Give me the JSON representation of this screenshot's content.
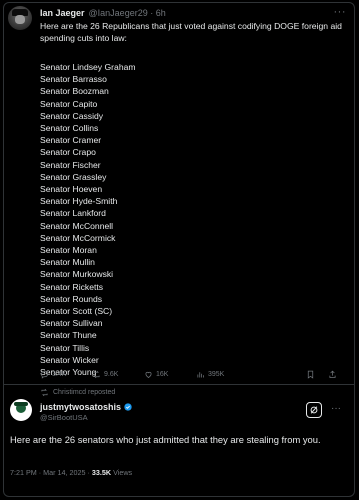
{
  "tweet": {
    "author_name": "Ian Jaeger",
    "author_handle": "@IanJaeger29 · 6h",
    "text": "Here are the 26 Republicans that just voted against codifying DOGE foreign aid spending cuts into law:",
    "senators": [
      "Senator Lindsey Graham",
      "Senator Barrasso",
      "Senator Boozman",
      "Senator Capito",
      "Senator Cassidy",
      "Senator Collins",
      "Senator Cramer",
      "Senator Crapo",
      "Senator Fischer",
      "Senator Grassley",
      "Senator Hoeven",
      "Senator Hyde-Smith",
      "Senator Lankford",
      "Senator McConnell",
      "Senator McCormick",
      "Senator Moran",
      "Senator Mullin",
      "Senator Murkowski",
      "Senator Ricketts",
      "Senator Rounds",
      "Senator Scott (SC)",
      "Senator Sullivan",
      "Senator Thune",
      "Senator Tillis",
      "Senator Wicker",
      "Senator Young"
    ],
    "actions": {
      "replies": "3.4K",
      "reposts": "9.6K",
      "likes": "16K",
      "views": "395K"
    }
  },
  "repost": {
    "reposted_by": "Christimcd reposted",
    "author_name": "justmytwosatoshis",
    "author_handle": "@SirBootUSA",
    "text": "Here are the 26 senators who just admitted that they are stealing from you.",
    "timestamp": "7:21 PM · Mar 14, 2025 · ",
    "views_count": "33.5K",
    "views_label": " Views"
  },
  "colors": {
    "background": "#000000",
    "text": "#e7e9ea",
    "muted": "#71767b",
    "verified": "#1d9bf0"
  },
  "icons": [
    "more-icon",
    "reply-icon",
    "repost-icon",
    "like-icon",
    "views-icon",
    "bookmark-icon",
    "share-icon",
    "verified-icon",
    "grok-icon"
  ]
}
